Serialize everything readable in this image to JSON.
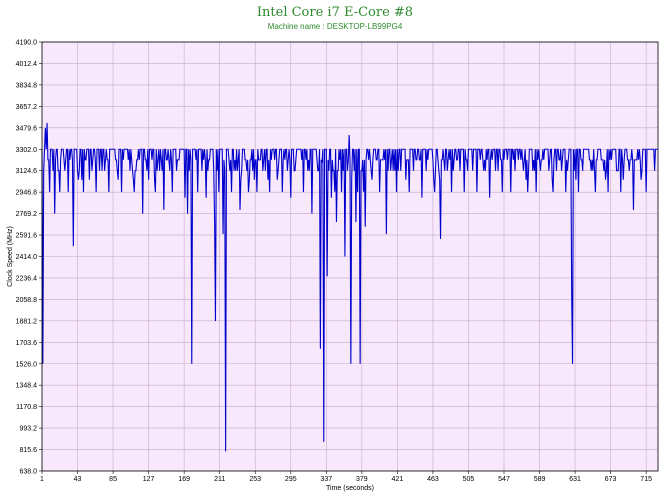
{
  "chart_data": {
    "type": "line",
    "title": "Intel Core i7 E-Core #8",
    "subtitle": "Machine name : DESKTOP-LB99PG4",
    "xlabel": "Time (seconds)",
    "ylabel": "Clock Speed (MHz)",
    "ylim": [
      638.0,
      4190.0
    ],
    "xlim": [
      1,
      729
    ],
    "y_ticks": [
      "4190.0",
      "4012.4",
      "3834.8",
      "3657.2",
      "3479.6",
      "3302.0",
      "3124.6",
      "2946.8",
      "2769.2",
      "2591.6",
      "2414.0",
      "2236.4",
      "2058.8",
      "1881.2",
      "1703.6",
      "1526.0",
      "1348.4",
      "1170.8",
      "993.2",
      "815.6",
      "638.0"
    ],
    "x_ticks": [
      "1",
      "43",
      "85",
      "127",
      "169",
      "211",
      "253",
      "295",
      "337",
      "379",
      "421",
      "463",
      "505",
      "547",
      "589",
      "631",
      "673",
      "715"
    ],
    "grid": true,
    "colors": {
      "line": "#0000cc",
      "plot_bg": "#f7e9fb",
      "grid": "#c8a8d0",
      "title": "#2e8b2e"
    },
    "baseline": {
      "low": 3214,
      "high": 3302
    },
    "series": [
      {
        "points": [
          [
            1,
            3302
          ],
          [
            2,
            1526
          ],
          [
            3,
            3124.6
          ],
          [
            5,
            3479.6
          ],
          [
            6,
            3302
          ],
          [
            7,
            3520
          ],
          [
            8,
            3214
          ],
          [
            10,
            2946.8
          ],
          [
            12,
            3302
          ],
          [
            14,
            3124.6
          ],
          [
            16,
            2769.2
          ],
          [
            18,
            3302
          ],
          [
            20,
            3124.6
          ],
          [
            22,
            2946.8
          ],
          [
            25,
            3302
          ],
          [
            28,
            3124.6
          ],
          [
            32,
            2946.8
          ],
          [
            35,
            3302
          ],
          [
            38,
            2500
          ],
          [
            40,
            3302
          ],
          [
            45,
            3124.6
          ],
          [
            50,
            2946.8
          ],
          [
            55,
            3302
          ],
          [
            60,
            3124.6
          ],
          [
            65,
            2946.8
          ],
          [
            70,
            3302
          ],
          [
            75,
            3124.6
          ],
          [
            80,
            2946.8
          ],
          [
            85,
            3302
          ],
          [
            90,
            3124.6
          ],
          [
            95,
            2946.8
          ],
          [
            100,
            3302
          ],
          [
            105,
            3124.6
          ],
          [
            110,
            2946.8
          ],
          [
            115,
            3302
          ],
          [
            120,
            2769.2
          ],
          [
            125,
            3124.6
          ],
          [
            130,
            3302
          ],
          [
            135,
            2946.8
          ],
          [
            140,
            3124.6
          ],
          [
            145,
            2800
          ],
          [
            150,
            3302
          ],
          [
            155,
            2946.8
          ],
          [
            160,
            3124.6
          ],
          [
            165,
            3302
          ],
          [
            170,
            2900
          ],
          [
            173,
            2769.2
          ],
          [
            175,
            3124.6
          ],
          [
            178,
            1526
          ],
          [
            180,
            3302
          ],
          [
            185,
            2946.8
          ],
          [
            190,
            3124.6
          ],
          [
            195,
            2900
          ],
          [
            200,
            3302
          ],
          [
            205,
            2700
          ],
          [
            206,
            1880
          ],
          [
            208,
            3124.6
          ],
          [
            210,
            2946.8
          ],
          [
            212,
            3302
          ],
          [
            215,
            2600
          ],
          [
            217,
            3124.6
          ],
          [
            218,
            800
          ],
          [
            220,
            3302
          ],
          [
            225,
            2946.8
          ],
          [
            230,
            3124.6
          ],
          [
            235,
            2800
          ],
          [
            240,
            3302
          ],
          [
            245,
            2946.8
          ],
          [
            250,
            3124.6
          ],
          [
            255,
            2946.8
          ],
          [
            260,
            3302
          ],
          [
            265,
            3124.6
          ],
          [
            270,
            2946.8
          ],
          [
            275,
            3302
          ],
          [
            280,
            3124.6
          ],
          [
            285,
            2946.8
          ],
          [
            290,
            3302
          ],
          [
            295,
            2900
          ],
          [
            300,
            3124.6
          ],
          [
            305,
            3302
          ],
          [
            310,
            2946.8
          ],
          [
            315,
            3124.6
          ],
          [
            320,
            2769.2
          ],
          [
            325,
            3302
          ],
          [
            328,
            3124.6
          ],
          [
            330,
            1650
          ],
          [
            332,
            3200
          ],
          [
            334,
            880
          ],
          [
            336,
            3302
          ],
          [
            338,
            2250
          ],
          [
            340,
            3124.6
          ],
          [
            343,
            2900
          ],
          [
            347,
            2950
          ],
          [
            349,
            2700
          ],
          [
            350,
            3124.6
          ],
          [
            352,
            3302
          ],
          [
            355,
            2946.8
          ],
          [
            357,
            3124.6
          ],
          [
            359,
            2414
          ],
          [
            360,
            3302
          ],
          [
            362,
            3124.6
          ],
          [
            364,
            3420
          ],
          [
            366,
            1526
          ],
          [
            368,
            3302
          ],
          [
            370,
            3124.6
          ],
          [
            372,
            2700
          ],
          [
            374,
            2946.8
          ],
          [
            375,
            3302
          ],
          [
            377,
            1526
          ],
          [
            379,
            3124.6
          ],
          [
            381,
            2950
          ],
          [
            383,
            2660
          ],
          [
            385,
            3302
          ],
          [
            390,
            3124.6
          ],
          [
            395,
            3302
          ],
          [
            400,
            2946.8
          ],
          [
            405,
            3302
          ],
          [
            408,
            2600
          ],
          [
            410,
            3124.6
          ],
          [
            415,
            3302
          ],
          [
            420,
            2946.8
          ],
          [
            425,
            3124.6
          ],
          [
            430,
            3302
          ],
          [
            435,
            2946.8
          ],
          [
            440,
            3124.6
          ],
          [
            445,
            3302
          ],
          [
            450,
            2900
          ],
          [
            455,
            3124.6
          ],
          [
            460,
            3302
          ],
          [
            465,
            2946.8
          ],
          [
            470,
            3124.6
          ],
          [
            472,
            2560
          ],
          [
            475,
            3302
          ],
          [
            480,
            3124.6
          ],
          [
            485,
            2946.8
          ],
          [
            490,
            3302
          ],
          [
            495,
            3124.6
          ],
          [
            500,
            2946.8
          ],
          [
            505,
            3302
          ],
          [
            510,
            3124.6
          ],
          [
            515,
            2946.8
          ],
          [
            520,
            3302
          ],
          [
            525,
            3124.6
          ],
          [
            530,
            2900
          ],
          [
            535,
            3302
          ],
          [
            540,
            3124.6
          ],
          [
            545,
            2946.8
          ],
          [
            550,
            3302
          ],
          [
            555,
            2946.8
          ],
          [
            560,
            3124.6
          ],
          [
            565,
            3302
          ],
          [
            570,
            3124.6
          ],
          [
            575,
            2946.8
          ],
          [
            580,
            3302
          ],
          [
            585,
            2946.8
          ],
          [
            590,
            3124.6
          ],
          [
            595,
            3302
          ],
          [
            600,
            3124.6
          ],
          [
            605,
            2946.8
          ],
          [
            610,
            3302
          ],
          [
            615,
            3124.6
          ],
          [
            620,
            2946.8
          ],
          [
            625,
            3302
          ],
          [
            627,
            2100
          ],
          [
            628,
            1526
          ],
          [
            630,
            3124.6
          ],
          [
            633,
            3302
          ],
          [
            635,
            2946.8
          ],
          [
            640,
            3124.6
          ],
          [
            645,
            3302
          ],
          [
            650,
            3124.6
          ],
          [
            655,
            2946.8
          ],
          [
            660,
            3302
          ],
          [
            665,
            3124.6
          ],
          [
            670,
            2946.8
          ],
          [
            675,
            3302
          ],
          [
            680,
            3124.6
          ],
          [
            685,
            2946.8
          ],
          [
            690,
            3302
          ],
          [
            695,
            3124.6
          ],
          [
            700,
            2800
          ],
          [
            705,
            3302
          ],
          [
            710,
            3124.6
          ],
          [
            715,
            2946.8
          ],
          [
            720,
            3302
          ],
          [
            725,
            3124.6
          ],
          [
            729,
            3302
          ]
        ]
      }
    ]
  }
}
